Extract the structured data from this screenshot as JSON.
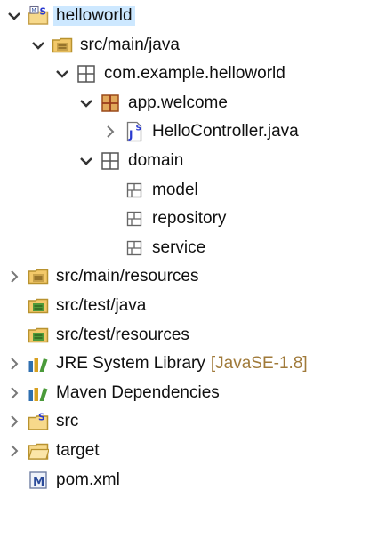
{
  "tree": [
    {
      "label": "helloworld",
      "depth": 0,
      "twisty": "expanded",
      "icon": "maven-project-icon",
      "selected": true
    },
    {
      "label": "src/main/java",
      "depth": 1,
      "twisty": "expanded",
      "icon": "source-folder-icon"
    },
    {
      "label": "com.example.helloworld",
      "depth": 2,
      "twisty": "expanded",
      "icon": "package-icon"
    },
    {
      "label": "app.welcome",
      "depth": 3,
      "twisty": "expanded",
      "icon": "package-filled-icon"
    },
    {
      "label": "HelloController.java",
      "depth": 4,
      "twisty": "collapsed",
      "icon": "java-file-icon"
    },
    {
      "label": "domain",
      "depth": 3,
      "twisty": "expanded",
      "icon": "package-icon"
    },
    {
      "label": "model",
      "depth": 4,
      "twisty": "none",
      "icon": "package-empty-icon"
    },
    {
      "label": "repository",
      "depth": 4,
      "twisty": "none",
      "icon": "package-empty-icon"
    },
    {
      "label": "service",
      "depth": 4,
      "twisty": "none",
      "icon": "package-empty-icon"
    },
    {
      "label": "src/main/resources",
      "depth": 0,
      "twisty": "collapsed",
      "icon": "source-folder-icon"
    },
    {
      "label": "src/test/java",
      "depth": 0,
      "twisty": "none",
      "icon": "source-folder-test-icon"
    },
    {
      "label": "src/test/resources",
      "depth": 0,
      "twisty": "none",
      "icon": "source-folder-test-icon"
    },
    {
      "label": "JRE System Library",
      "decoration": "[JavaSE-1.8]",
      "depth": 0,
      "twisty": "collapsed",
      "icon": "library-icon"
    },
    {
      "label": "Maven Dependencies",
      "depth": 0,
      "twisty": "collapsed",
      "icon": "library-icon"
    },
    {
      "label": "src",
      "depth": 0,
      "twisty": "collapsed",
      "icon": "folder-s-icon"
    },
    {
      "label": "target",
      "depth": 0,
      "twisty": "collapsed",
      "icon": "folder-icon"
    },
    {
      "label": "pom.xml",
      "depth": 0,
      "twisty": "none",
      "icon": "pom-file-icon"
    }
  ],
  "colors": {
    "selection": "#cde8ff",
    "text": "#101010",
    "decoration": "#a07a3a",
    "twisty": "#333333"
  }
}
